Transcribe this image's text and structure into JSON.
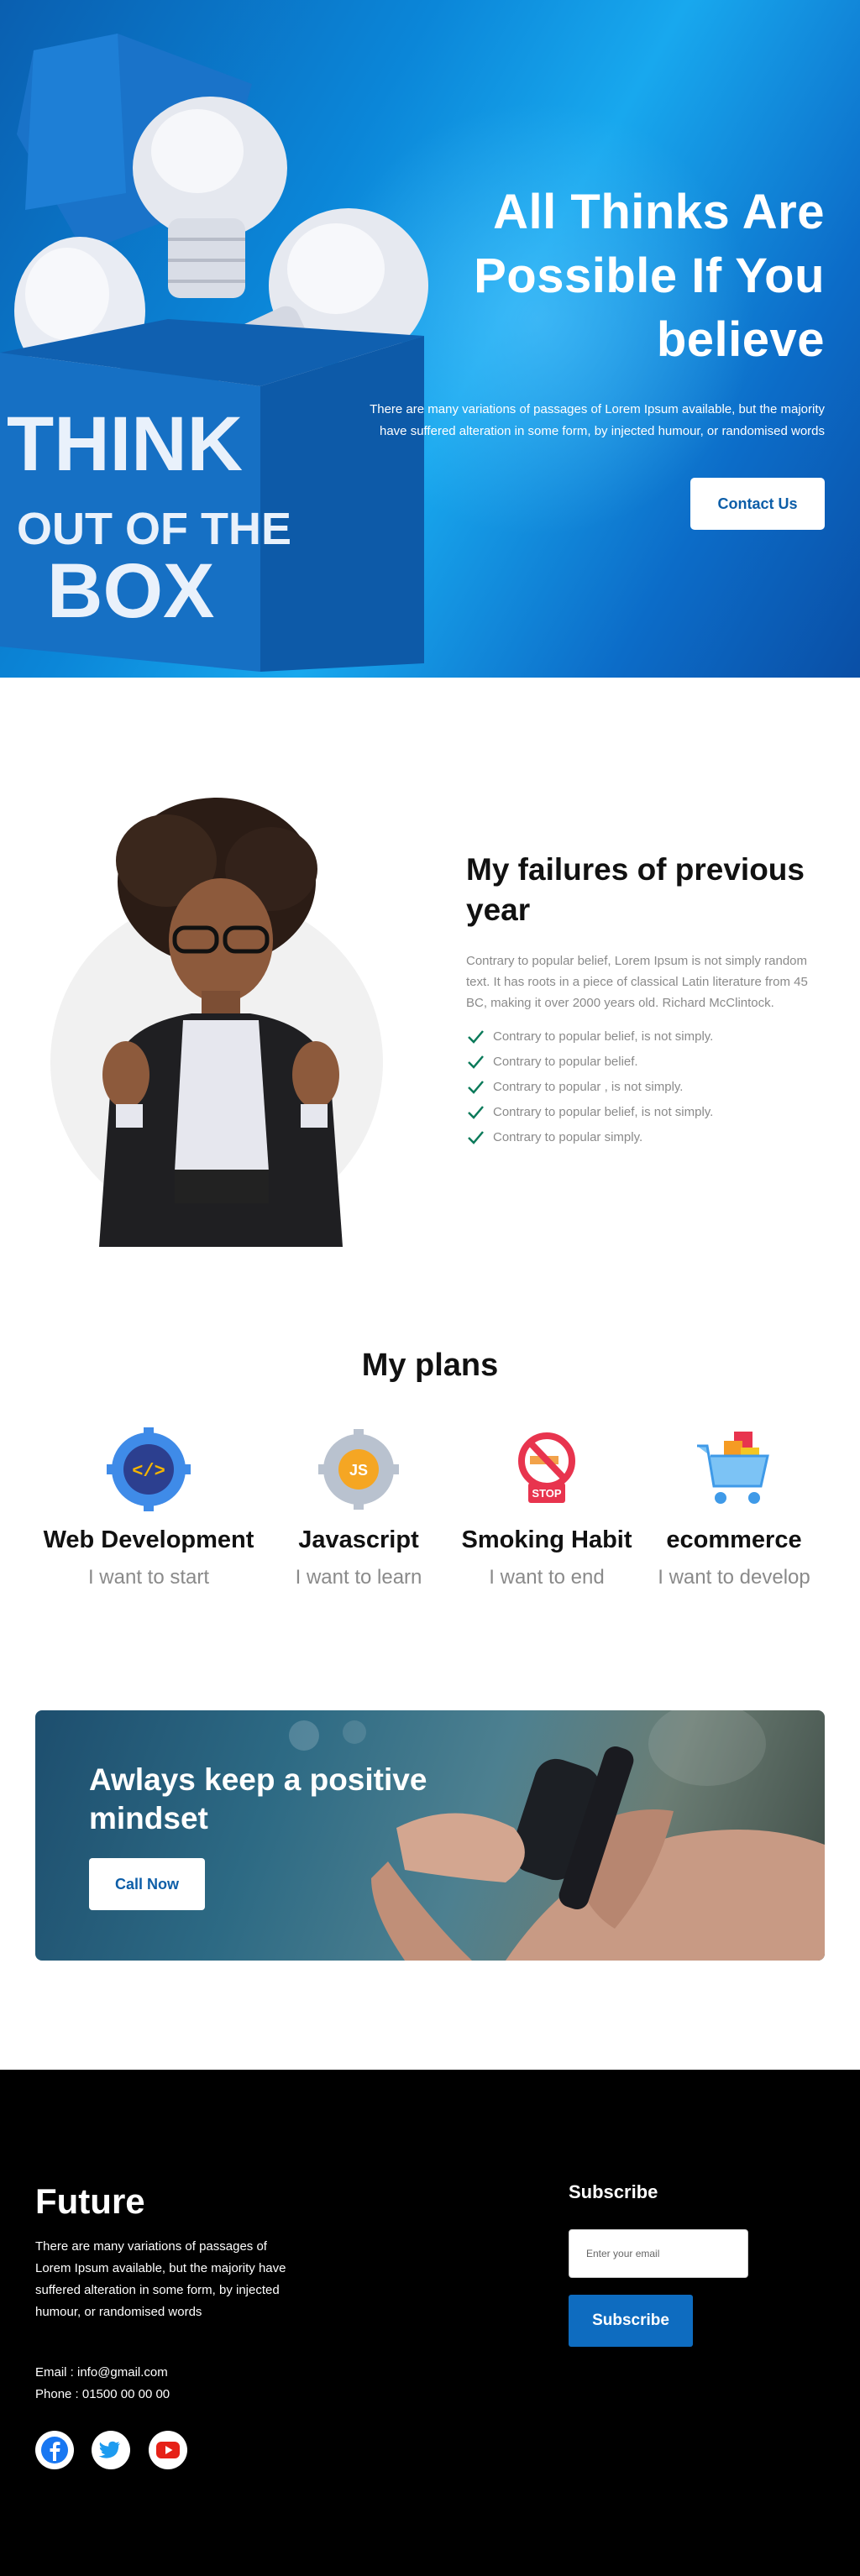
{
  "hero": {
    "title": "All Thinks Are Possible If You believe",
    "text": "There are many variations of passages of Lorem Ipsum available, but the majority have suffered alteration in some form, by injected humour, or randomised words",
    "button": "Contact Us",
    "box_text": [
      "THINK",
      "OUT OF THE",
      "BOX"
    ]
  },
  "failures": {
    "title": "My failures of previous year",
    "paragraph": "Contrary to popular belief, Lorem Ipsum is not simply random text. It has roots in a piece of classical Latin literature from 45 BC, making it over 2000 years old. Richard McClintock.",
    "items": [
      "Contrary to popular belief, is not simply.",
      "Contrary to popular belief.",
      "Contrary to popular , is not simply.",
      "Contrary to popular belief, is not simply.",
      "Contrary to popular simply."
    ],
    "check_color": "#0b7a5a"
  },
  "plans": {
    "title": "My plans",
    "items": [
      {
        "title": "Web Development",
        "subtitle": "I want to start",
        "icon": "code-gear-icon"
      },
      {
        "title": "Javascript",
        "subtitle": "I want to learn",
        "icon": "js-gear-icon"
      },
      {
        "title": "Smoking Habit",
        "subtitle": "I want to end",
        "icon": "no-smoking-icon"
      },
      {
        "title": "ecommerce",
        "subtitle": "I want to develop",
        "icon": "shopping-cart-icon"
      }
    ]
  },
  "banner": {
    "title": "Awlays keep a positive mindset",
    "button": "Call Now"
  },
  "footer": {
    "brand": "Future",
    "text": "There are many variations of passages of Lorem Ipsum available, but the majority have suffered alteration in some form, by injected humour, or randomised words",
    "email": "Email : info@gmail.com",
    "phone": "Phone : 01500 00 00 00",
    "social": [
      "facebook-icon",
      "twitter-icon",
      "youtube-icon"
    ],
    "subscribe_title": "Subscribe",
    "subscribe_placeholder": "Enter your email",
    "subscribe_button": "Subscribe"
  },
  "colors": {
    "accent": "#0e6cc0",
    "footer_bg": "#000000",
    "hero_blue": "#0b86d8"
  }
}
